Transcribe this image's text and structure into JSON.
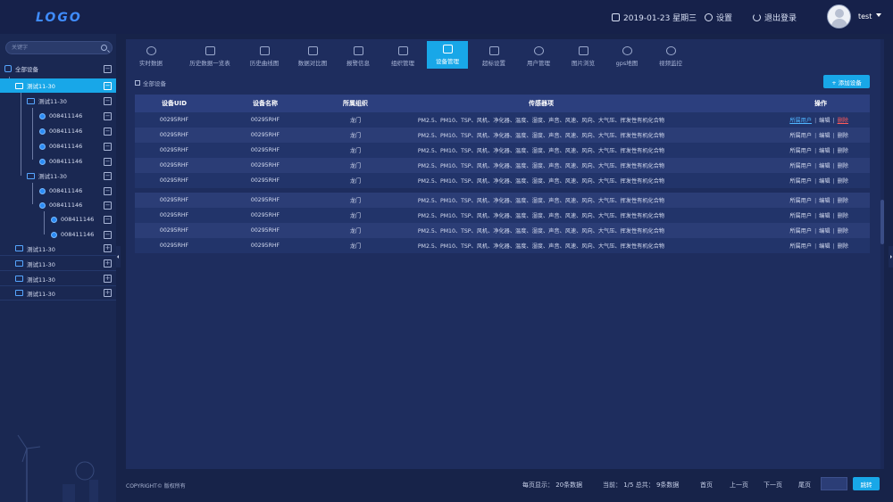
{
  "header": {
    "logo": "LOGO",
    "date": "2019-01-23 星期三",
    "settings_label": "设置",
    "logout_label": "退出登录",
    "user_name": "test"
  },
  "sidebar": {
    "search_placeholder": "关键字",
    "root_label": "全部设备",
    "nodes": [
      {
        "label": "测试11-30",
        "toggle": "−"
      },
      {
        "label": "测试11-30",
        "toggle": "−"
      },
      {
        "label": "008411146",
        "toggle": "−"
      },
      {
        "label": "008411146",
        "toggle": "−"
      },
      {
        "label": "008411146",
        "toggle": "−"
      },
      {
        "label": "008411146",
        "toggle": "−"
      },
      {
        "label": "测试11-30",
        "toggle": "−"
      },
      {
        "label": "008411146",
        "toggle": "−"
      },
      {
        "label": "008411146",
        "toggle": "−"
      },
      {
        "label": "008411146",
        "toggle": "−"
      },
      {
        "label": "008411146",
        "toggle": "−"
      },
      {
        "label": "测试11-30",
        "toggle": "+"
      },
      {
        "label": "测试11-30",
        "toggle": "+"
      },
      {
        "label": "测试11-30",
        "toggle": "+"
      },
      {
        "label": "测试11-30",
        "toggle": "+"
      }
    ],
    "root_toggle": "−"
  },
  "tabs": [
    {
      "label": "实时数据"
    },
    {
      "label": "历史数据一览表"
    },
    {
      "label": "历史曲线图"
    },
    {
      "label": "数据对比图"
    },
    {
      "label": "报警信息"
    },
    {
      "label": "组织管理"
    },
    {
      "label": "设备管理"
    },
    {
      "label": "超标设置"
    },
    {
      "label": "用户管理"
    },
    {
      "label": "图片浏览"
    },
    {
      "label": "gps地图"
    },
    {
      "label": "视频监控"
    }
  ],
  "breadcrumb": "全部设备",
  "add_button": "+ 添加设备",
  "table": {
    "headers": [
      "设备UID",
      "设备名称",
      "所属组织",
      "传感器项",
      "操作"
    ],
    "rows": [
      {
        "uid": "00295RHF",
        "name": "00295RHF",
        "org": "龙门",
        "sensors": "PM2.5、PM10、TSP、风机、净化器、温度、湿度、声音、风速、风向、大气压、挥发性有机化合物"
      },
      {
        "uid": "00295RHF",
        "name": "00295RHF",
        "org": "龙门",
        "sensors": "PM2.5、PM10、TSP、风机、净化器、温度、湿度、声音、风速、风向、大气压、挥发性有机化合物"
      },
      {
        "uid": "00295RHF",
        "name": "00295RHF",
        "org": "龙门",
        "sensors": "PM2.5、PM10、TSP、风机、净化器、温度、湿度、声音、风速、风向、大气压、挥发性有机化合物"
      },
      {
        "uid": "00295RHF",
        "name": "00295RHF",
        "org": "龙门",
        "sensors": "PM2.5、PM10、TSP、风机、净化器、温度、湿度、声音、风速、风向、大气压、挥发性有机化合物"
      },
      {
        "uid": "00295RHF",
        "name": "00295RHF",
        "org": "龙门",
        "sensors": "PM2.5、PM10、TSP、风机、净化器、温度、湿度、声音、风速、风向、大气压、挥发性有机化合物"
      },
      {
        "uid": "00295RHF",
        "name": "00295RHF",
        "org": "龙门",
        "sensors": "PM2.5、PM10、TSP、风机、净化器、温度、湿度、声音、风速、风向、大气压、挥发性有机化合物"
      },
      {
        "uid": "00295RHF",
        "name": "00295RHF",
        "org": "龙门",
        "sensors": "PM2.5、PM10、TSP、风机、净化器、温度、湿度、声音、风速、风向、大气压、挥发性有机化合物"
      },
      {
        "uid": "00295RHF",
        "name": "00295RHF",
        "org": "龙门",
        "sensors": "PM2.5、PM10、TSP、风机、净化器、温度、湿度、声音、风速、风向、大气压、挥发性有机化合物"
      },
      {
        "uid": "00295RHF",
        "name": "00295RHF",
        "org": "龙门",
        "sensors": "PM2.5、PM10、TSP、风机、净化器、温度、湿度、声音、风速、风向、大气压、挥发性有机化合物"
      }
    ],
    "op_users": "所属用户",
    "op_edit": "编辑",
    "op_delete": "删除",
    "op_sep": "|"
  },
  "footer": {
    "copyright": "COPYRIGHT© 版权所有",
    "per_page": "每页显示：  20条数据",
    "current": "当前：  1/5  总共：  9条数据",
    "first": "首页",
    "prev": "上一页",
    "next": "下一页",
    "last": "尾页",
    "jump": "跳转"
  },
  "colors": {
    "accent": "#18a7e8",
    "danger": "#ff5a5a",
    "link": "#4fb4ff"
  }
}
